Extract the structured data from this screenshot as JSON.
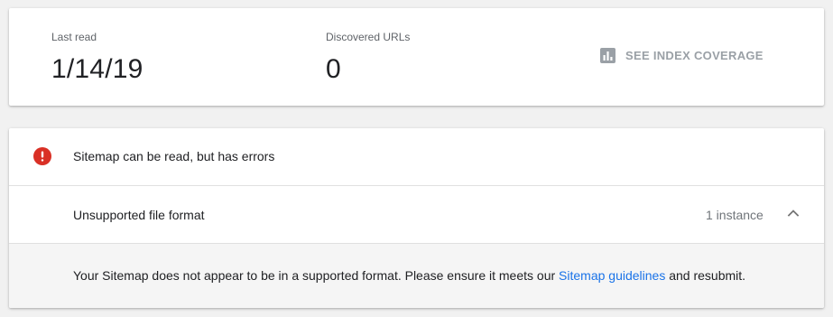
{
  "stats": {
    "last_read": {
      "label": "Last read",
      "value": "1/14/19"
    },
    "discovered_urls": {
      "label": "Discovered URLs",
      "value": "0"
    },
    "coverage_link": {
      "label": "SEE INDEX COVERAGE",
      "icon": "bar-chart-icon"
    }
  },
  "errors": {
    "status": {
      "icon": "error-icon",
      "text": "Sitemap can be read, but has errors"
    },
    "issue": {
      "label": "Unsupported file format",
      "count": "1 instance",
      "icon": "chevron-up-icon"
    },
    "detail": {
      "text_before": "Your Sitemap does not appear to be in a supported format. Please ensure it meets our ",
      "link_text": "Sitemap guidelines",
      "text_after": " and resubmit."
    }
  },
  "colors": {
    "error": "#d93025",
    "link": "#1a73e8",
    "muted": "#9aa0a6"
  }
}
